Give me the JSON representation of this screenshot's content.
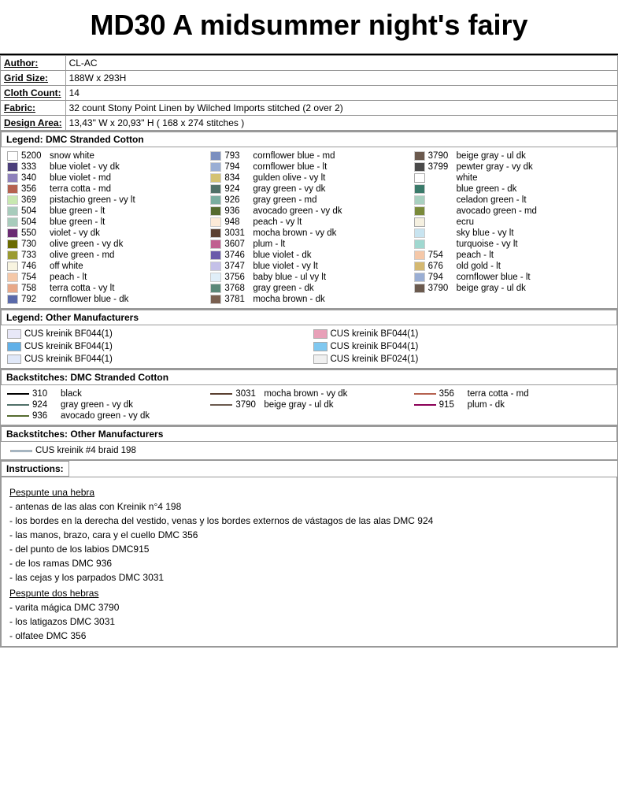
{
  "title": "MD30 A midsummer night's fairy",
  "info": {
    "author_label": "Author:",
    "author_value": "CL-AC",
    "grid_label": "Grid Size:",
    "grid_value": "188W x 293H",
    "cloth_label": "Cloth Count:",
    "cloth_value": "14",
    "fabric_label": "Fabric:",
    "fabric_value": "32 count Stony Point Linen by Wilched Imports stitched (2 over 2)",
    "design_label": "Design Area:",
    "design_value": "13,43\" W  x  20,93\" H   ( 168 x 274 stitches )"
  },
  "legend_dmc_header": "Legend: DMC Stranded Cotton",
  "legend_dmc": [
    {
      "num": "5200",
      "name": "snow white",
      "color": "#FFFFFF"
    },
    {
      "num": "793",
      "name": "cornflower blue - md",
      "color": "#7B8FBF"
    },
    {
      "num": "3790",
      "name": "beige gray - ul dk",
      "color": "#6B5A4E"
    },
    {
      "num": "333",
      "name": "blue violet - vy dk",
      "color": "#4B3F7A"
    },
    {
      "num": "794",
      "name": "cornflower blue - lt",
      "color": "#9AAED4"
    },
    {
      "num": "3799",
      "name": "pewter gray - vy dk",
      "color": "#4A4A4A"
    },
    {
      "num": "340",
      "name": "blue violet - md",
      "color": "#8E81BB"
    },
    {
      "num": "834",
      "name": "gulden olive - vy lt",
      "color": "#D4C272"
    },
    {
      "num": "",
      "name": "white",
      "color": "#FFFFFF"
    },
    {
      "num": "356",
      "name": "terra cotta - md",
      "color": "#B56250"
    },
    {
      "num": "924",
      "name": "gray green - vy dk",
      "color": "#507068"
    },
    {
      "num": "",
      "name": "blue green - dk",
      "color": "#3A7A6A"
    },
    {
      "num": "369",
      "name": "pistachio green - vy lt",
      "color": "#C8E8B0"
    },
    {
      "num": "926",
      "name": "gray green - md",
      "color": "#7AADA0"
    },
    {
      "num": "",
      "name": "celadon green - lt",
      "color": "#A8D0C0"
    },
    {
      "num": "504",
      "name": "blue green - lt",
      "color": "#A8CCBC"
    },
    {
      "num": "936",
      "name": "avocado green - vy dk",
      "color": "#556B2F"
    },
    {
      "num": "",
      "name": "avocado green - md",
      "color": "#7A8A3A"
    },
    {
      "num": "504",
      "name": "blue green - lt",
      "color": "#A8CCBC"
    },
    {
      "num": "948",
      "name": "peach - vy lt",
      "color": "#FDEBD8"
    },
    {
      "num": "",
      "name": "ecru",
      "color": "#F5F0E0"
    },
    {
      "num": "550",
      "name": "violet - vy dk",
      "color": "#6A2A72"
    },
    {
      "num": "3031",
      "name": "mocha brown - vy dk",
      "color": "#5A4030"
    },
    {
      "num": "",
      "name": "sky blue - vy lt",
      "color": "#C8E4F0"
    },
    {
      "num": "730",
      "name": "olive green - vy dk",
      "color": "#6B6B00"
    },
    {
      "num": "3607",
      "name": "plum - lt",
      "color": "#C06090"
    },
    {
      "num": "",
      "name": "turquoise - vy lt",
      "color": "#A0D8D0"
    },
    {
      "num": "733",
      "name": "olive green - md",
      "color": "#9A9A30"
    },
    {
      "num": "3746",
      "name": "blue violet - dk",
      "color": "#6A5AAA"
    },
    {
      "num": "754",
      "name": "peach - lt",
      "color": "#F5C8A8"
    },
    {
      "num": "746",
      "name": "off white",
      "color": "#F8F4E0"
    },
    {
      "num": "3747",
      "name": "blue violet - vy lt",
      "color": "#C4C0E8"
    },
    {
      "num": "676",
      "name": "old gold - lt",
      "color": "#D4B870"
    },
    {
      "num": "754",
      "name": "peach - lt",
      "color": "#F5C8A8"
    },
    {
      "num": "3756",
      "name": "baby blue - ul vy lt",
      "color": "#E0EEF8"
    },
    {
      "num": "794",
      "name": "cornflower blue - lt",
      "color": "#9AAED4"
    },
    {
      "num": "758",
      "name": "terra cotta - vy lt",
      "color": "#E8A888"
    },
    {
      "num": "3768",
      "name": "gray green - dk",
      "color": "#5A8878"
    },
    {
      "num": "3790",
      "name": "beige gray - ul dk",
      "color": "#6B5A4E"
    },
    {
      "num": "792",
      "name": "cornflower blue - dk",
      "color": "#5A6AAA"
    },
    {
      "num": "3781",
      "name": "mocha brown - dk",
      "color": "#7A6050"
    }
  ],
  "legend_other_header": "Legend: Other Manufacturers",
  "legend_other": [
    {
      "swatch_color": "#E8E8F8",
      "text": "CUS kreinik  BF044(1)"
    },
    {
      "swatch_color": "#E8A0B8",
      "text": "CUS kreinik  BF044(1)"
    },
    {
      "swatch_color": "#60B0E8",
      "text": "CUS kreinik  BF044(1)"
    },
    {
      "swatch_color": "#80C8F0",
      "text": "CUS kreinik  BF044(1)"
    },
    {
      "swatch_color": "#E0E8F8",
      "text": "CUS kreinik  BF044(1)"
    },
    {
      "swatch_color": "#F0F0F0",
      "text": "CUS kreinik  BF024(1)"
    }
  ],
  "backstitch_dmc_header": "Backstitches: DMC Stranded Cotton",
  "backstitches_dmc": [
    {
      "num": "310",
      "name": "black",
      "color": "#000000"
    },
    {
      "num": "3031",
      "name": "mocha brown - vy dk",
      "color": "#5A4030"
    },
    {
      "num": "356",
      "name": "terra cotta - md",
      "color": "#B56250"
    },
    {
      "num": "924",
      "name": "gray green - vy dk",
      "color": "#507068"
    },
    {
      "num": "3790",
      "name": "beige gray - ul dk",
      "color": "#6B5A4E"
    },
    {
      "num": "915",
      "name": "plum - dk",
      "color": "#8B0057"
    },
    {
      "num": "936",
      "name": "avocado green - vy dk",
      "color": "#556B2F"
    }
  ],
  "backstitch_other_header": "Backstitches: Other Manufacturers",
  "backstitch_other": [
    {
      "swatch_color": "#A0C8E8",
      "text": "CUS kreinik  #4 braid 198"
    }
  ],
  "instructions_header": "Instructions:",
  "instructions_lines": [
    {
      "type": "section",
      "text": "Pespunte una hebra"
    },
    {
      "type": "blank"
    },
    {
      "type": "text",
      "text": "- antenas de las alas con Kreinik n°4 198"
    },
    {
      "type": "blank"
    },
    {
      "type": "text",
      "text": "- los bordes en la derecha del vestido, venas y los bordes externos de vástagos de las alas DMC 924"
    },
    {
      "type": "blank"
    },
    {
      "type": "text",
      "text": "- las manos, brazo, cara y el cuello DMC 356"
    },
    {
      "type": "blank"
    },
    {
      "type": "text",
      "text": "- del punto de los labios DMC915"
    },
    {
      "type": "blank"
    },
    {
      "type": "text",
      "text": "- de los ramas DMC 936"
    },
    {
      "type": "blank"
    },
    {
      "type": "text",
      "text": "- las cejas y los parpados DMC 3031"
    },
    {
      "type": "section",
      "text": "Pespunte dos hebras"
    },
    {
      "type": "blank"
    },
    {
      "type": "text",
      "text": "- varita mágica DMC 3790"
    },
    {
      "type": "blank"
    },
    {
      "type": "text",
      "text": "- los latigazos DMC 3031"
    },
    {
      "type": "blank"
    },
    {
      "type": "text",
      "text": "- olfatee DMC 356"
    }
  ]
}
